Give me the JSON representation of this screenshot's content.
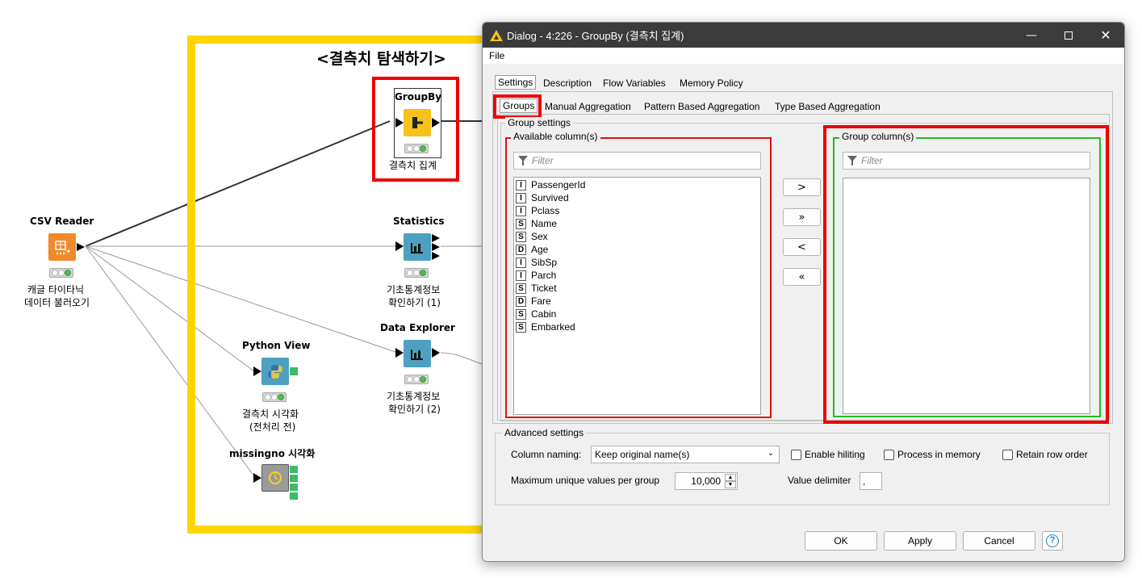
{
  "workflow": {
    "annotation_title": "<결측치 탐색하기>",
    "nodes": {
      "csv_reader": {
        "title": "CSV Reader",
        "label_line1": "캐글 타이타닉",
        "label_line2": "데이터 불러오기"
      },
      "groupby": {
        "title": "GroupBy",
        "label": "결측치 집계"
      },
      "statistics": {
        "title": "Statistics",
        "label_line1": "기초통계정보",
        "label_line2": "확인하기 (1)"
      },
      "data_explorer": {
        "title": "Data Explorer",
        "label_line1": "기초통계정보",
        "label_line2": "확인하기 (2)"
      },
      "python_view": {
        "title": "Python View",
        "label_line1": "결측치 시각화",
        "label_line2": "(전처리 전)"
      },
      "missingno": {
        "title": "missingno 시각화"
      }
    },
    "colors": {
      "annotation_border": "#FFD500",
      "highlight_red": "#EE0000",
      "highlight_green": "#22BB22",
      "node_orange": "#F08A2C",
      "node_yellow": "#F6C21A",
      "node_blue": "#4EA0C0"
    }
  },
  "dialog": {
    "title": "Dialog - 4:226 - GroupBy (결측치 집계)",
    "menu": {
      "file": "File"
    },
    "tabs": [
      "Settings",
      "Description",
      "Flow Variables",
      "Memory Policy"
    ],
    "subtabs": [
      "Groups",
      "Manual Aggregation",
      "Pattern Based Aggregation",
      "Type Based Aggregation"
    ],
    "group_settings_legend": "Group settings",
    "available_legend": "Available column(s)",
    "group_columns_legend": "Group column(s)",
    "filter_placeholder": "Filter",
    "columns": [
      {
        "type": "I",
        "name": "PassengerId"
      },
      {
        "type": "I",
        "name": "Survived"
      },
      {
        "type": "I",
        "name": "Pclass"
      },
      {
        "type": "S",
        "name": "Name"
      },
      {
        "type": "S",
        "name": "Sex"
      },
      {
        "type": "D",
        "name": "Age"
      },
      {
        "type": "I",
        "name": "SibSp"
      },
      {
        "type": "I",
        "name": "Parch"
      },
      {
        "type": "S",
        "name": "Ticket"
      },
      {
        "type": "D",
        "name": "Fare"
      },
      {
        "type": "S",
        "name": "Cabin"
      },
      {
        "type": "S",
        "name": "Embarked"
      }
    ],
    "move_buttons": [
      ">",
      "»",
      "<",
      "«"
    ],
    "advanced_legend": "Advanced settings",
    "column_naming_label": "Column naming:",
    "column_naming_value": "Keep original name(s)",
    "enable_hiliting": "Enable hiliting",
    "process_in_memory": "Process in memory",
    "retain_row_order": "Retain row order",
    "max_unique_label": "Maximum unique values per group",
    "max_unique_value": "10,000",
    "value_delimiter_label": "Value delimiter",
    "value_delimiter_value": ",",
    "ok": "OK",
    "apply": "Apply",
    "cancel": "Cancel",
    "help": "?"
  }
}
